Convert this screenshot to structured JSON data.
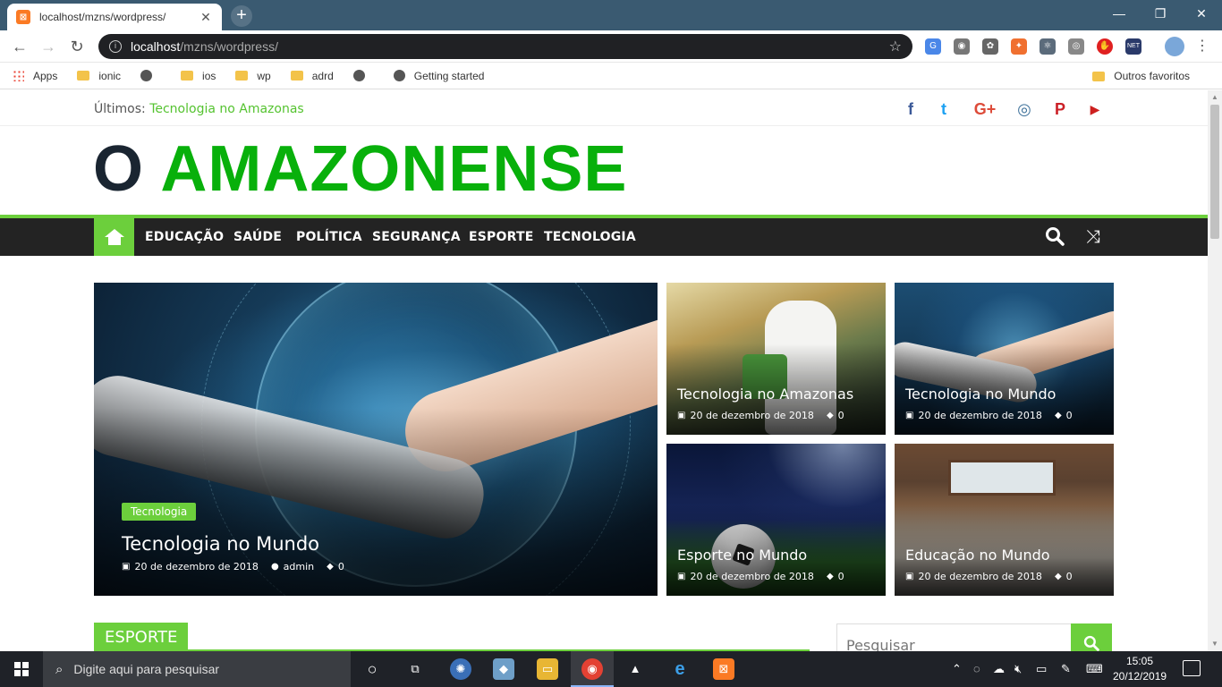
{
  "browser": {
    "tab_title": "localhost/mzns/wordpress/",
    "tab_favicon": "xampp-icon",
    "url_host": "localhost",
    "url_path": "/mzns/wordpress/",
    "bookmarks": [
      {
        "label": "Apps",
        "icon": "apps-grid-icon"
      },
      {
        "label": "ionic",
        "icon": "folder-icon"
      },
      {
        "label": "",
        "icon": "globe-icon"
      },
      {
        "label": "ios",
        "icon": "folder-icon"
      },
      {
        "label": "wp",
        "icon": "folder-icon"
      },
      {
        "label": "adrd",
        "icon": "folder-icon"
      },
      {
        "label": "",
        "icon": "globe-icon"
      },
      {
        "label": "Getting started",
        "icon": "globe-icon"
      }
    ],
    "other_bookmarks": "Outros favoritos"
  },
  "site": {
    "latest_label": "Últimos:",
    "latest_link": "Tecnologia no Amazonas",
    "logo_first": "O",
    "logo_rest": "AMAZONENSE",
    "nav": [
      "EDUCAÇÃO",
      "SAÚDE",
      "POLÍTICA",
      "SEGURANÇA",
      "ESPORTE",
      "TECNOLOGIA"
    ],
    "social": [
      {
        "icon": "facebook-icon",
        "glyph": "f",
        "color": "#3b5998"
      },
      {
        "icon": "twitter-icon",
        "glyph": "t",
        "color": "#1da1f2"
      },
      {
        "icon": "google-plus-icon",
        "glyph": "G+",
        "color": "#dd4b39"
      },
      {
        "icon": "instagram-icon",
        "glyph": "◎",
        "color": "#3f729b"
      },
      {
        "icon": "pinterest-icon",
        "glyph": "P",
        "color": "#cb2027"
      },
      {
        "icon": "youtube-icon",
        "glyph": "▶",
        "color": "#cd201f"
      }
    ],
    "featured_main": {
      "category": "Tecnologia",
      "title": "Tecnologia no Mundo",
      "date": "20 de dezembro de 2018",
      "author": "admin",
      "comments": "0"
    },
    "featured_small": [
      {
        "title": "Tecnologia no Amazonas",
        "date": "20 de dezembro de 2018",
        "comments": "0"
      },
      {
        "title": "Tecnologia no Mundo",
        "date": "20 de dezembro de 2018",
        "comments": "0"
      },
      {
        "title": "Esporte no Mundo",
        "date": "20 de dezembro de 2018",
        "comments": "0"
      },
      {
        "title": "Educação no Mundo",
        "date": "20 de dezembro de 2018",
        "comments": "0"
      }
    ],
    "section_title": "ESPORTE",
    "search_placeholder": "Pesquisar"
  },
  "taskbar": {
    "search_placeholder": "Digite aqui para pesquisar",
    "time": "15:05",
    "date": "20/12/2019"
  },
  "colors": {
    "accent": "#6ccf3c",
    "logo_green": "#08b00b",
    "logo_dark": "#1a2531",
    "nav_bg": "#232323"
  }
}
